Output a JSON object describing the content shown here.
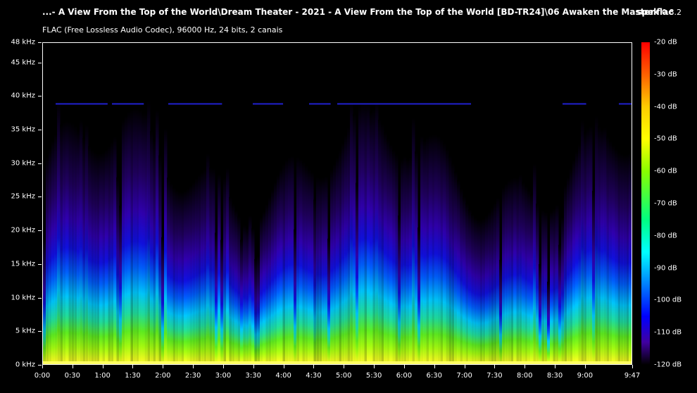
{
  "header": {
    "file_path": "...- A View From the Top of the World\\Dream Theater - 2021 - A View From the Top of the World [BD-TR24]\\06 Awaken the Master.flac",
    "app_name": "spek",
    "app_version": "0.8.2",
    "format_info": "FLAC (Free Lossless Audio Codec), 96000 Hz, 24 bits, 2 canais"
  },
  "chart_data": {
    "type": "heatmap",
    "y_axis": {
      "unit": "kHz",
      "ylim": [
        0,
        48
      ],
      "ticks": [
        {
          "value": 0,
          "label": "0 kHz"
        },
        {
          "value": 5,
          "label": "5 kHz"
        },
        {
          "value": 10,
          "label": "10 kHz"
        },
        {
          "value": 15,
          "label": "15 kHz"
        },
        {
          "value": 20,
          "label": "20 kHz"
        },
        {
          "value": 25,
          "label": "25 kHz"
        },
        {
          "value": 30,
          "label": "30 kHz"
        },
        {
          "value": 35,
          "label": "35 kHz"
        },
        {
          "value": 40,
          "label": "40 kHz"
        },
        {
          "value": 45,
          "label": "45 kHz"
        },
        {
          "value": 48,
          "label": "48 kHz"
        }
      ]
    },
    "x_axis": {
      "unit": "seconds",
      "xlim": [
        0,
        587
      ],
      "ticks": [
        {
          "value": 0,
          "label": "0:00"
        },
        {
          "value": 30,
          "label": "0:30"
        },
        {
          "value": 60,
          "label": "1:00"
        },
        {
          "value": 90,
          "label": "1:30"
        },
        {
          "value": 120,
          "label": "2:00"
        },
        {
          "value": 150,
          "label": "2:30"
        },
        {
          "value": 180,
          "label": "3:00"
        },
        {
          "value": 210,
          "label": "3:30"
        },
        {
          "value": 240,
          "label": "4:00"
        },
        {
          "value": 270,
          "label": "4:30"
        },
        {
          "value": 300,
          "label": "5:00"
        },
        {
          "value": 330,
          "label": "5:30"
        },
        {
          "value": 360,
          "label": "6:00"
        },
        {
          "value": 390,
          "label": "6:30"
        },
        {
          "value": 420,
          "label": "7:00"
        },
        {
          "value": 450,
          "label": "7:30"
        },
        {
          "value": 480,
          "label": "8:00"
        },
        {
          "value": 510,
          "label": "8:30"
        },
        {
          "value": 540,
          "label": "9:00"
        },
        {
          "value": 587,
          "label": "9:47"
        }
      ]
    },
    "color_scale": {
      "unit": "dB",
      "range": [
        -120,
        -20
      ],
      "ticks": [
        {
          "value": -20,
          "label": "-20 dB"
        },
        {
          "value": -30,
          "label": "-30 dB"
        },
        {
          "value": -40,
          "label": "-40 dB"
        },
        {
          "value": -50,
          "label": "-50 dB"
        },
        {
          "value": -60,
          "label": "-60 dB"
        },
        {
          "value": -70,
          "label": "-70 dB"
        },
        {
          "value": -80,
          "label": "-80 dB"
        },
        {
          "value": -90,
          "label": "-90 dB"
        },
        {
          "value": -100,
          "label": "-100 dB"
        },
        {
          "value": -110,
          "label": "-110 dB"
        },
        {
          "value": -120,
          "label": "-120 dB"
        }
      ]
    }
  }
}
